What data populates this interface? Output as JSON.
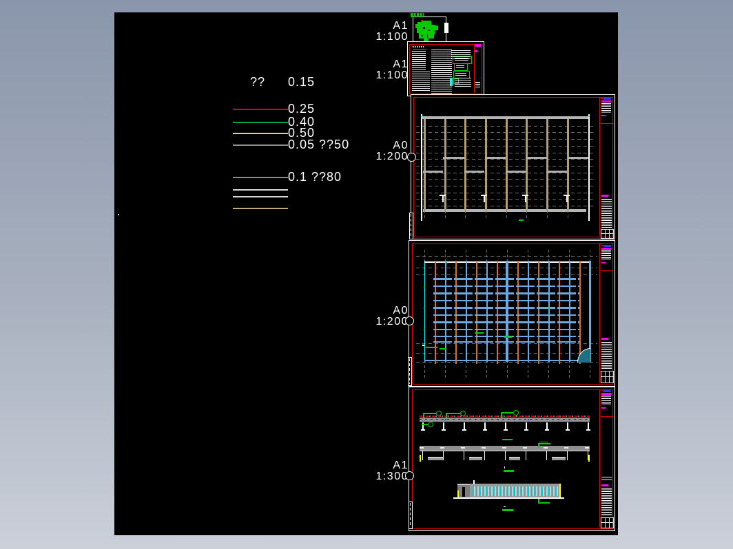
{
  "legend": {
    "header_left": "??",
    "header_right": "0.15",
    "items": [
      {
        "label": "0.25",
        "color": "#e10000"
      },
      {
        "label": "0.40",
        "color": "#00a551"
      },
      {
        "label": "0.50",
        "color": "#ffe100"
      },
      {
        "label": "0.05 ??50",
        "color": "#8c8c8c"
      },
      {
        "label": "0.1 ??80",
        "color": "#8c8c8c"
      }
    ]
  },
  "sheet_labels": [
    {
      "size": "A1",
      "scale": "1:100"
    },
    {
      "size": "A1",
      "scale": "1:100"
    },
    {
      "size": "A0",
      "scale": "1:200"
    },
    {
      "size": "A0",
      "scale": "1:200"
    },
    {
      "size": "A1",
      "scale": "1:300"
    }
  ],
  "colors": {
    "canvas_bg": "#000000",
    "frame_top": "#8a96ab",
    "frame_bottom": "#cbd0d9",
    "sheet_border_red": "#e00000",
    "cad_green": "#00cc00",
    "tan": "#c3ab74",
    "column_tan": "#b49e6a",
    "grid_gray": "#6f6f6f",
    "beam_gray": "#b0b0b0",
    "blue": "#69a9e4",
    "orange": "#d9731a",
    "cyan": "#00ffff",
    "magenta": "#ff00ff",
    "teal": "#1d7086",
    "extra_line_white": "#d9d9d9"
  }
}
